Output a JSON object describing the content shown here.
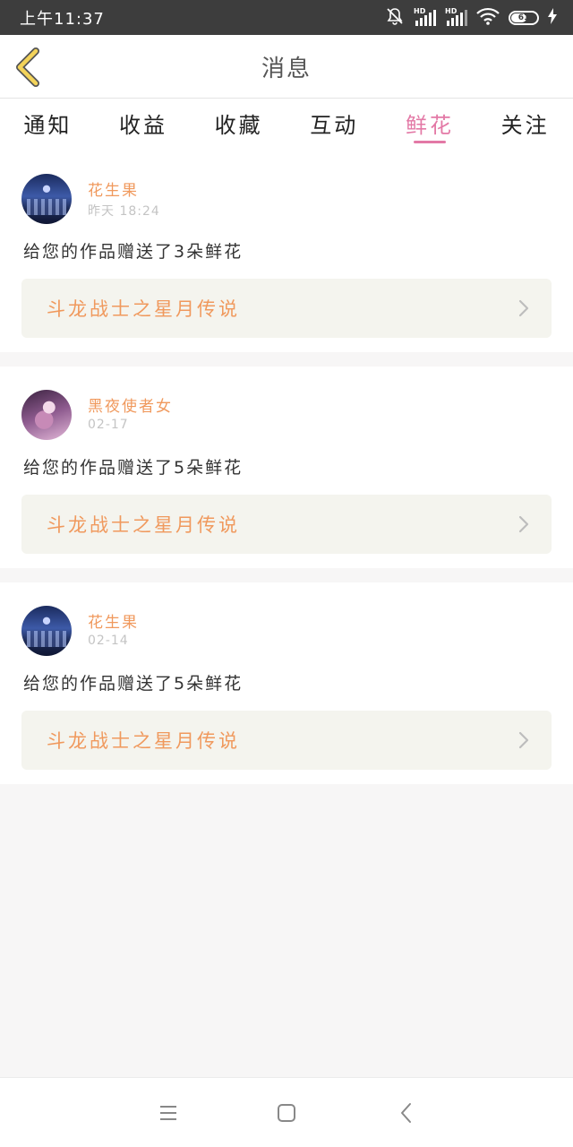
{
  "status_bar": {
    "time": "上午11:37",
    "battery": "61",
    "signal_badge": "HD",
    "colors": {
      "background": "#3d3d3d",
      "text": "#ffffff"
    },
    "icons": [
      "mute-bell-icon",
      "signal-icon",
      "signal-icon",
      "wifi-icon",
      "battery-icon",
      "charging-icon"
    ]
  },
  "header": {
    "title": "消息",
    "back_icon": "chevron-left-icon",
    "back_color": "#f3d35a"
  },
  "tabs": [
    {
      "label": "通知",
      "active": false
    },
    {
      "label": "收益",
      "active": false
    },
    {
      "label": "收藏",
      "active": false
    },
    {
      "label": "互动",
      "active": false
    },
    {
      "label": "鲜花",
      "active": true
    },
    {
      "label": "关注",
      "active": false
    }
  ],
  "accent_color": "#e379a6",
  "messages": [
    {
      "user": "花生果",
      "time": "昨天 18:24",
      "text": "给您的作品赠送了3朵鲜花",
      "work": "斗龙战士之星月传说"
    },
    {
      "user": "黑夜使者女",
      "time": "02-17",
      "text": "给您的作品赠送了5朵鲜花",
      "work": "斗龙战士之星月传说"
    },
    {
      "user": "花生果",
      "time": "02-14",
      "text": "给您的作品赠送了5朵鲜花",
      "work": "斗龙战士之星月传说"
    }
  ],
  "nav_bar": {
    "icons": [
      "menu-icon",
      "home-icon",
      "back-icon"
    ]
  }
}
